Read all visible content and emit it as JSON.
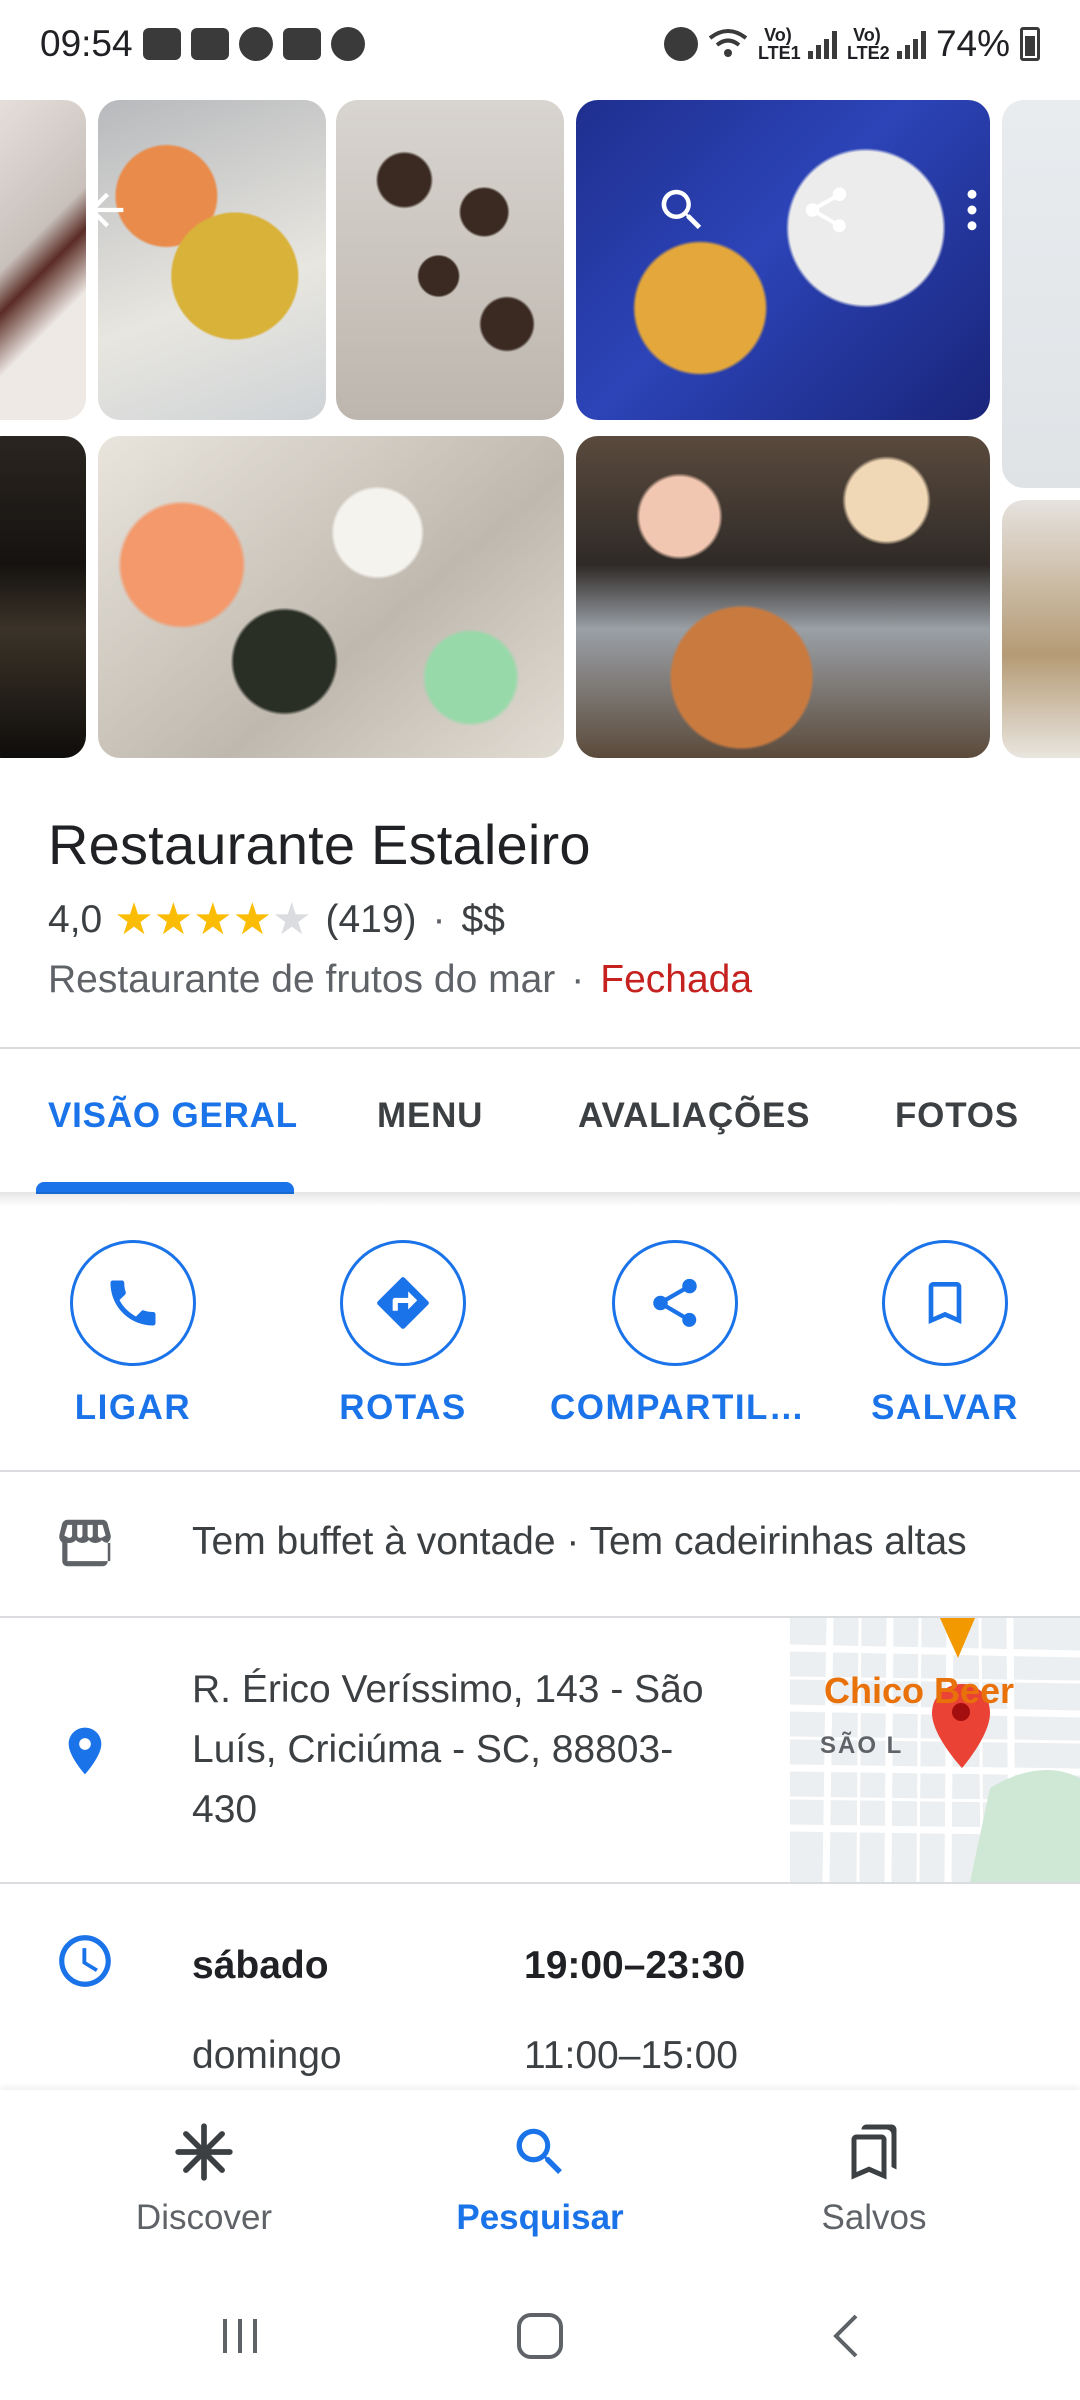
{
  "status_bar": {
    "time": "09:54",
    "lte1": "Vo) LTE1",
    "lte2": "Vo) LTE2",
    "battery": "74%"
  },
  "place": {
    "name": "Restaurante Estaleiro",
    "rating": "4,0",
    "stars_filled": 4,
    "reviews_count": "(419)",
    "separator": "·",
    "price": "$$",
    "category": "Restaurante de frutos do mar",
    "status": "Fechada"
  },
  "tabs": [
    {
      "label": "VISÃO GERAL"
    },
    {
      "label": "MENU"
    },
    {
      "label": "AVALIAÇÕES"
    },
    {
      "label": "FOTOS"
    }
  ],
  "actions": [
    {
      "label": "LIGAR",
      "icon": "phone-icon"
    },
    {
      "label": "ROTAS",
      "icon": "directions-icon"
    },
    {
      "label": "COMPARTIL…",
      "icon": "share-icon"
    },
    {
      "label": "SALVAR",
      "icon": "bookmark-icon"
    }
  ],
  "amenities": {
    "text": "Tem buffet à vontade · Tem cadeirinhas altas",
    "icon": "storefront-icon"
  },
  "address": {
    "line1": "R. Érico Veríssimo, 143 - São",
    "line2": "Luís, Criciúma - SC, 88803-",
    "line3": "430",
    "icon": "location-pin-icon"
  },
  "map": {
    "label": "Chico Beer",
    "area": "SÃO L"
  },
  "hours": [
    {
      "day": "sábado",
      "time": "19:00–23:30"
    },
    {
      "day": "domingo",
      "time": "11:00–15:00"
    }
  ],
  "bottom_nav": [
    {
      "label": "Discover",
      "icon": "asterisk-icon"
    },
    {
      "label": "Pesquisar",
      "icon": "search-icon"
    },
    {
      "label": "Salvos",
      "icon": "bookmarks-icon"
    }
  ],
  "colors": {
    "accent": "#1a73e8",
    "star": "#fbbc04",
    "closed": "#c5221f"
  }
}
